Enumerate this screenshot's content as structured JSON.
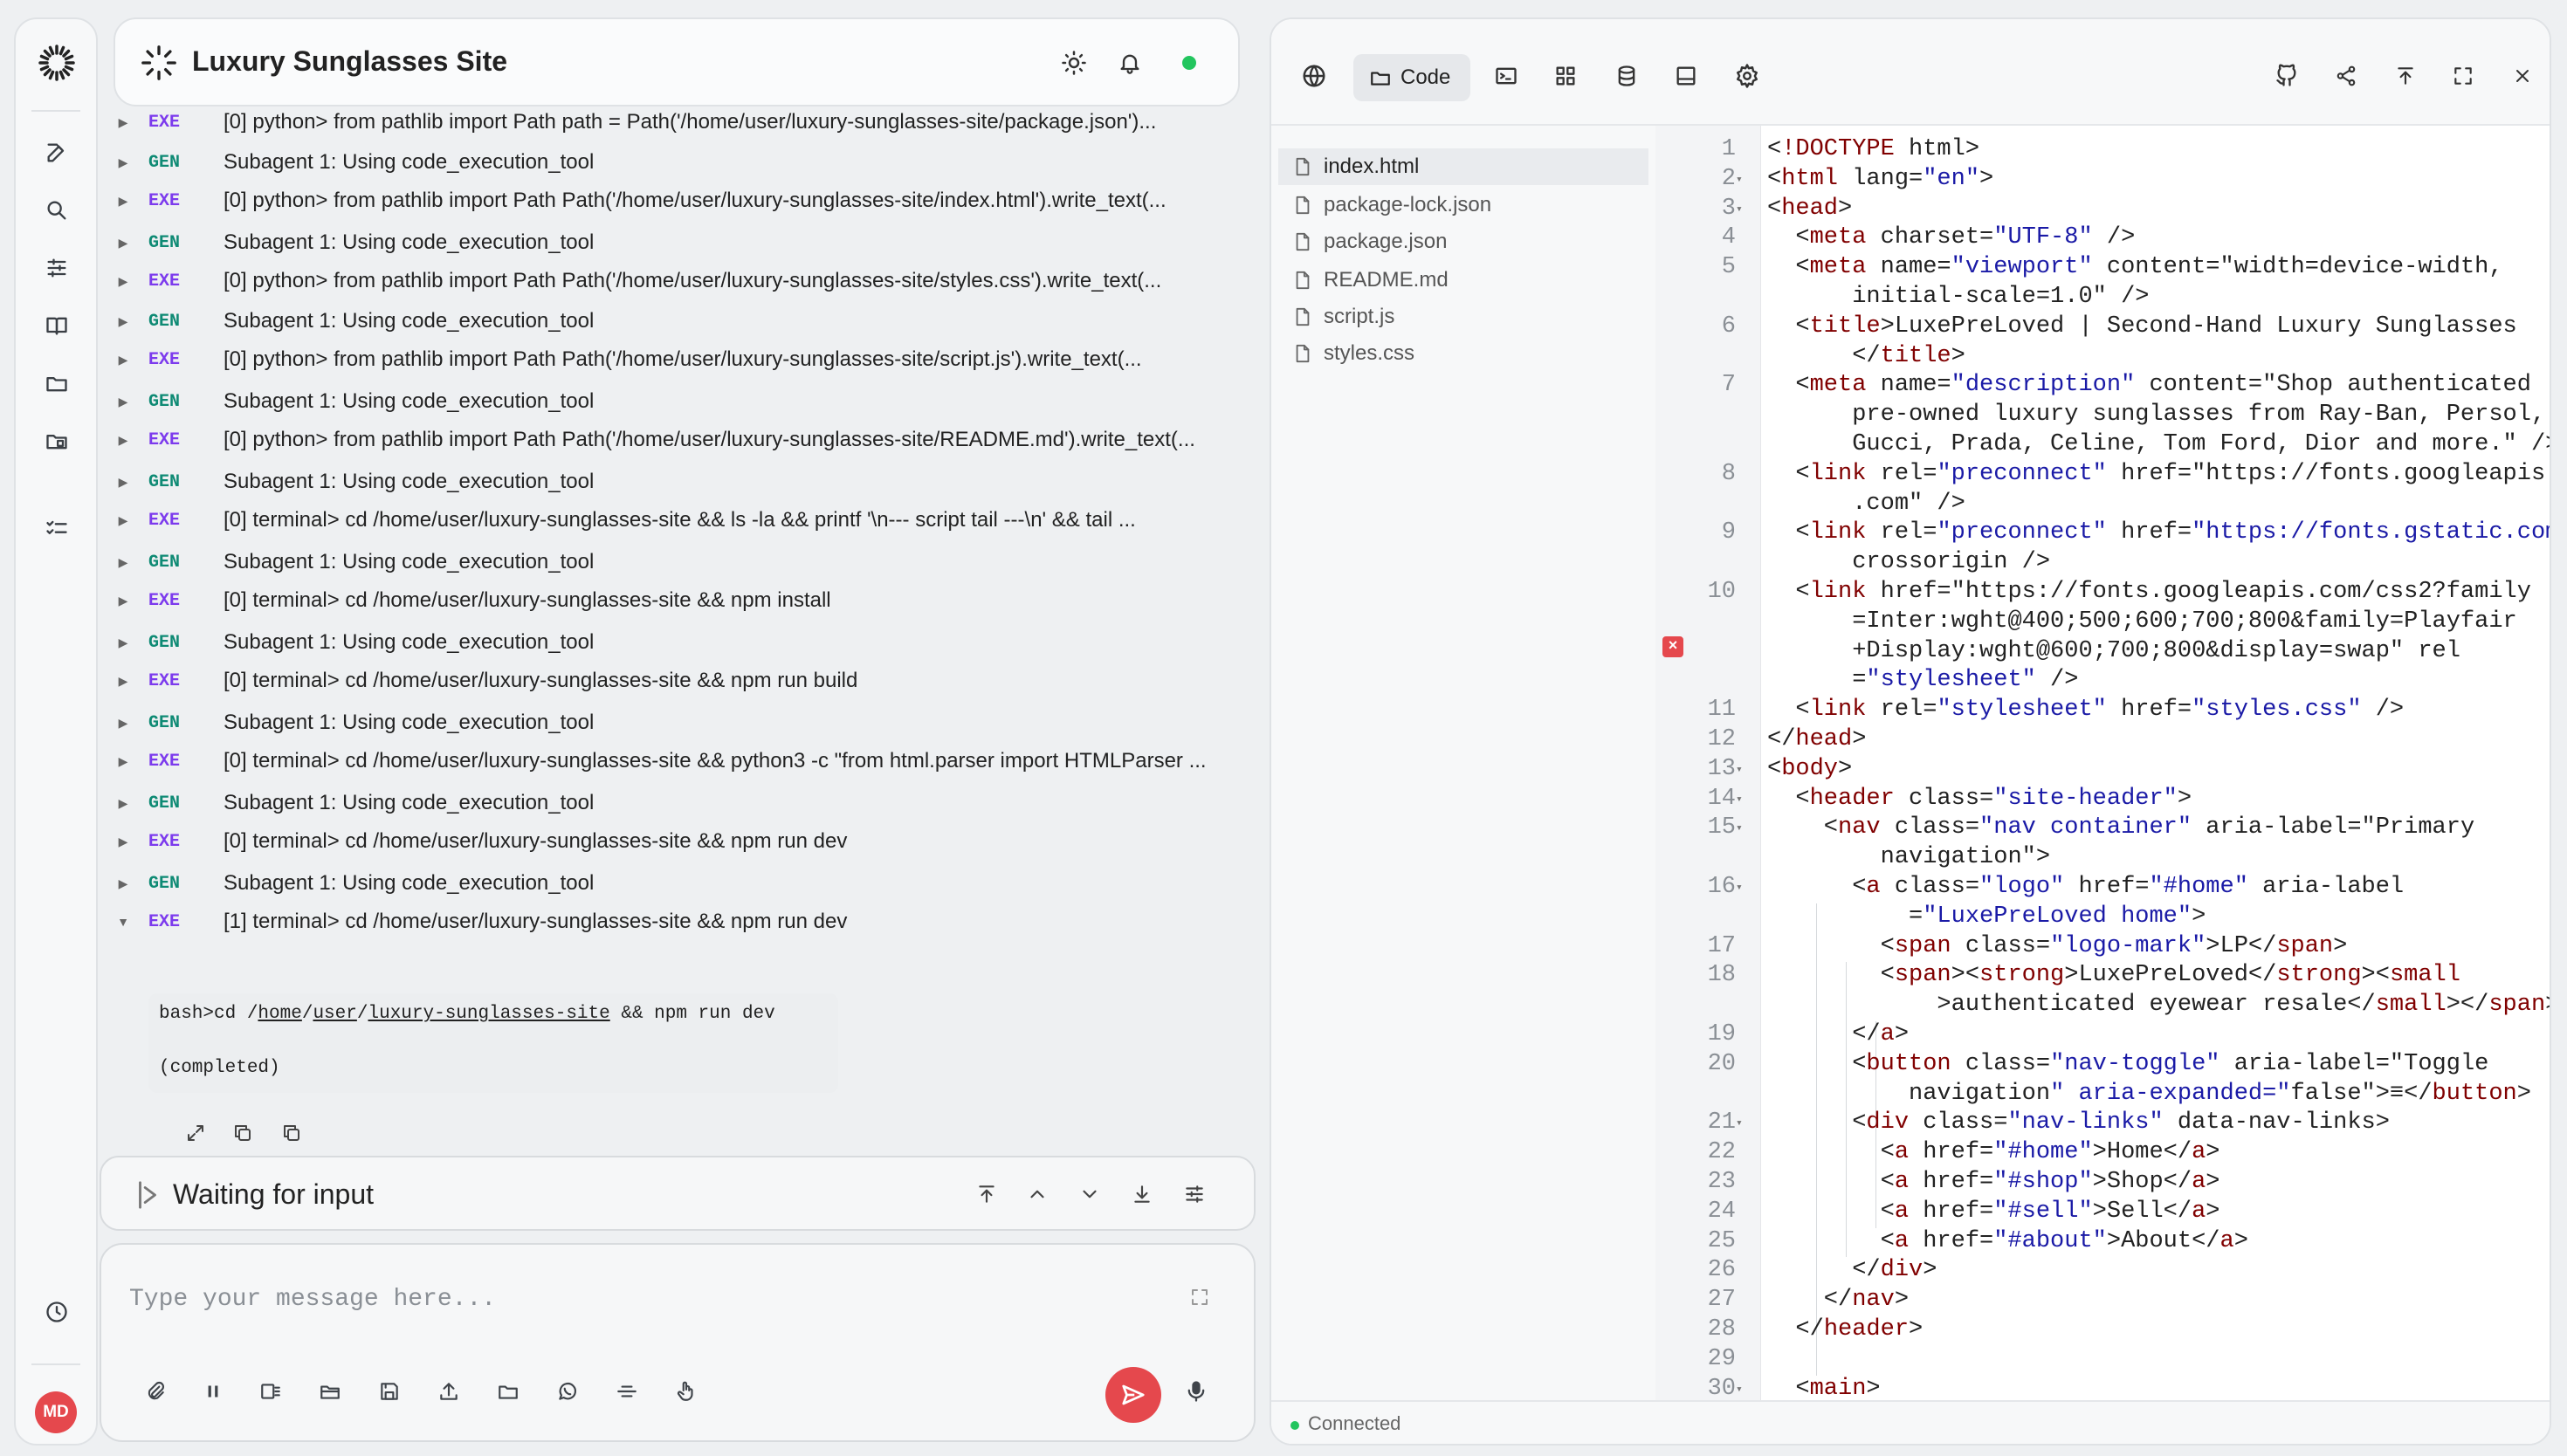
{
  "app": {
    "title": "Luxury Sunglasses Site",
    "avatar_initials": "MD",
    "status_dot_color": "#22c55e",
    "accent": "#e5484d"
  },
  "sidebar": {
    "items": [
      {
        "name": "new-chat",
        "icon": "edit-icon"
      },
      {
        "name": "search",
        "icon": "search-icon"
      },
      {
        "name": "settings",
        "icon": "sliders-icon"
      },
      {
        "name": "library",
        "icon": "book-icon"
      },
      {
        "name": "files",
        "icon": "folder-icon"
      },
      {
        "name": "projects",
        "icon": "folder-badge-icon"
      },
      {
        "name": "tasks",
        "icon": "checklist-icon"
      },
      {
        "name": "history",
        "icon": "clock-icon"
      }
    ]
  },
  "log": {
    "rows": [
      {
        "tag": "EXE",
        "text": "[0] python> from pathlib import Path path = Path('/home/user/luxury-sunglasses-site/package.json')..."
      },
      {
        "tag": "GEN",
        "text": "Subagent 1: Using code_execution_tool"
      },
      {
        "tag": "EXE",
        "text": "[0] python> from pathlib import Path Path('/home/user/luxury-sunglasses-site/index.html').write_text(..."
      },
      {
        "tag": "GEN",
        "text": "Subagent 1: Using code_execution_tool"
      },
      {
        "tag": "EXE",
        "text": "[0] python> from pathlib import Path Path('/home/user/luxury-sunglasses-site/styles.css').write_text(..."
      },
      {
        "tag": "GEN",
        "text": "Subagent 1: Using code_execution_tool"
      },
      {
        "tag": "EXE",
        "text": "[0] python> from pathlib import Path Path('/home/user/luxury-sunglasses-site/script.js').write_text(..."
      },
      {
        "tag": "GEN",
        "text": "Subagent 1: Using code_execution_tool"
      },
      {
        "tag": "EXE",
        "text": "[0] python> from pathlib import Path Path('/home/user/luxury-sunglasses-site/README.md').write_text(..."
      },
      {
        "tag": "GEN",
        "text": "Subagent 1: Using code_execution_tool"
      },
      {
        "tag": "EXE",
        "text": "[0] terminal> cd /home/user/luxury-sunglasses-site && ls -la && printf '\\n--- script tail ---\\n' && tail ..."
      },
      {
        "tag": "GEN",
        "text": "Subagent 1: Using code_execution_tool"
      },
      {
        "tag": "EXE",
        "text": "[0] terminal> cd /home/user/luxury-sunglasses-site && npm install"
      },
      {
        "tag": "GEN",
        "text": "Subagent 1: Using code_execution_tool"
      },
      {
        "tag": "EXE",
        "text": "[0] terminal> cd /home/user/luxury-sunglasses-site && npm run build"
      },
      {
        "tag": "GEN",
        "text": "Subagent 1: Using code_execution_tool"
      },
      {
        "tag": "EXE",
        "text": "[0] terminal> cd /home/user/luxury-sunglasses-site && python3 -c \"from html.parser import HTMLParser ..."
      },
      {
        "tag": "GEN",
        "text": "Subagent 1: Using code_execution_tool"
      },
      {
        "tag": "EXE",
        "text": "[0] terminal> cd /home/user/luxury-sunglasses-site && npm run dev"
      },
      {
        "tag": "GEN",
        "text": "Subagent 1: Using code_execution_tool"
      },
      {
        "tag": "EXE",
        "text": "[1] terminal> cd /home/user/luxury-sunglasses-site && npm run dev"
      }
    ],
    "bash": {
      "prefix": "bash>cd /",
      "p1": "home",
      "sep1": "/",
      "p2": "user",
      "sep2": "/",
      "p3": "luxury-sunglasses-site",
      "suffix": " && npm run dev",
      "result": "(completed)"
    }
  },
  "status": {
    "text": "Waiting for input"
  },
  "composer": {
    "placeholder": "Type your message here..."
  },
  "code": {
    "tab_label": "Code",
    "files": [
      "index.html",
      "package-lock.json",
      "package.json",
      "README.md",
      "script.js",
      "styles.css"
    ],
    "active_file": "index.html",
    "line_numbers": [
      "1",
      "2",
      "3",
      "4",
      "5",
      "6",
      "7",
      "8",
      "9",
      "10",
      "11",
      "12",
      "13",
      "14",
      "15",
      "16",
      "17",
      "18",
      "19",
      "20",
      "21",
      "22",
      "23",
      "24",
      "25",
      "26",
      "27",
      "28",
      "29",
      "30"
    ],
    "lines": [
      "<!DOCTYPE html>",
      "<html lang=\"en\">",
      "<head>",
      "  <meta charset=\"UTF-8\" />",
      "  <meta name=\"viewport\" content=\"width=device-width,",
      "      initial-scale=1.0\" />",
      "  <title>LuxePreLoved | Second-Hand Luxury Sunglasses",
      "      </title>",
      "  <meta name=\"description\" content=\"Shop authenticated",
      "      pre-owned luxury sunglasses from Ray-Ban, Persol,",
      "      Gucci, Prada, Celine, Tom Ford, Dior and more.\" />",
      "  <link rel=\"preconnect\" href=\"https://fonts.googleapis",
      "      .com\" />",
      "  <link rel=\"preconnect\" href=\"https://fonts.gstatic.com\"",
      "      crossorigin />",
      "  <link href=\"https://fonts.googleapis.com/css2?family",
      "      =Inter:wght@400;500;600;700;800&family=Playfair",
      "      +Display:wght@600;700;800&display=swap\" rel",
      "      =\"stylesheet\" />",
      "  <link rel=\"stylesheet\" href=\"styles.css\" />",
      "</head>",
      "<body>",
      "  <header class=\"site-header\">",
      "    <nav class=\"nav container\" aria-label=\"Primary",
      "        navigation\">",
      "      <a class=\"logo\" href=\"#home\" aria-label",
      "          =\"LuxePreLoved home\">",
      "        <span class=\"logo-mark\">LP</span>",
      "        <span><strong>LuxePreLoved</strong><small",
      "            >authenticated eyewear resale</small></span>",
      "      </a>",
      "      <button class=\"nav-toggle\" aria-label=\"Toggle",
      "          navigation\" aria-expanded=\"false\">≡</button>",
      "      <div class=\"nav-links\" data-nav-links>",
      "        <a href=\"#home\">Home</a>",
      "        <a href=\"#shop\">Shop</a>",
      "        <a href=\"#sell\">Sell</a>",
      "        <a href=\"#about\">About</a>",
      "      </div>",
      "    </nav>",
      "  </header>",
      "",
      "  <main>"
    ],
    "connection": "Connected"
  }
}
